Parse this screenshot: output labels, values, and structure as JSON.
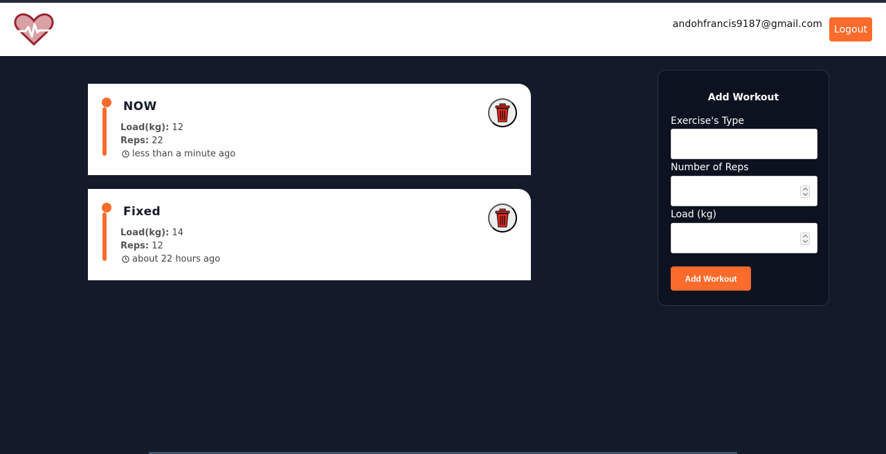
{
  "header": {
    "user_email": "andohfrancis9187@gmail.com",
    "logout_label": "Logout"
  },
  "workouts": [
    {
      "title": "NOW",
      "load_label": "Load(kg):",
      "load_value": "12",
      "reps_label": "Reps:",
      "reps_value": "22",
      "time": "less than a minute ago"
    },
    {
      "title": "Fixed",
      "load_label": "Load(kg):",
      "load_value": "14",
      "reps_label": "Reps:",
      "reps_value": "12",
      "time": "about 22 hours ago"
    }
  ],
  "form": {
    "title": "Add Workout",
    "type_label": "Exercise's Type",
    "type_value": "",
    "reps_label": "Number of Reps",
    "reps_value": "",
    "load_label": "Load (kg)",
    "load_value": "",
    "submit_label": "Add Workout"
  },
  "icons": {
    "logo": "heart-pulse-icon",
    "delete": "trash-icon",
    "time": "clock-icon"
  },
  "colors": {
    "accent": "#fb6b2c",
    "background": "#131a2a",
    "card": "#ffffff"
  }
}
